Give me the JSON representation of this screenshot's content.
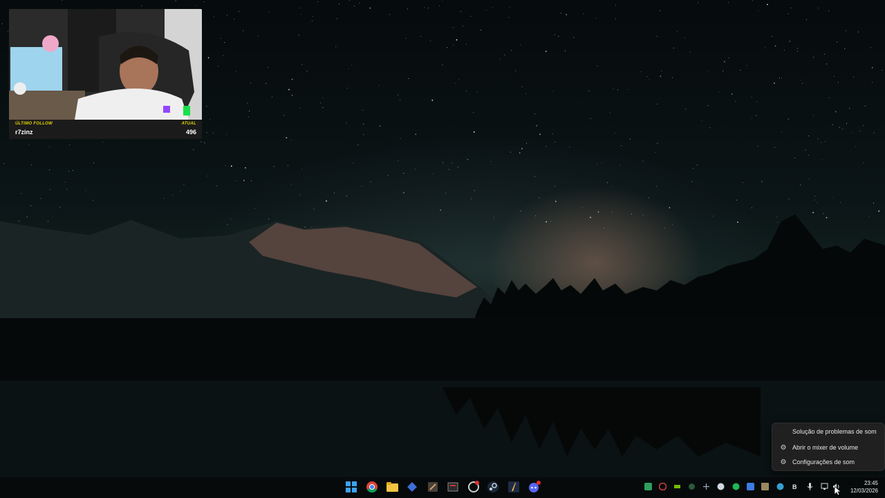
{
  "webcam_overlay": {
    "last_follow_label": "ÚLTIMO FOLLOW",
    "last_follow_name": "r7zinz",
    "current_label": "ATUAL",
    "current_value": "496"
  },
  "context_menu": {
    "items": [
      {
        "label": "Solução de problemas de som",
        "icon": "none"
      },
      {
        "label": "Abrir o mixer de volume",
        "icon": "gear-icon"
      },
      {
        "label": "Configurações de som",
        "icon": "gear-icon"
      }
    ]
  },
  "taskbar": {
    "pinned_apps": [
      "start-icon",
      "chrome-icon",
      "file-explorer-icon",
      "app-icon",
      "app-icon",
      "app-icon",
      "app-icon",
      "steam-icon",
      "app-icon",
      "discord-icon"
    ],
    "clock": {
      "time": "23:45",
      "date": "12/03/2026"
    }
  }
}
